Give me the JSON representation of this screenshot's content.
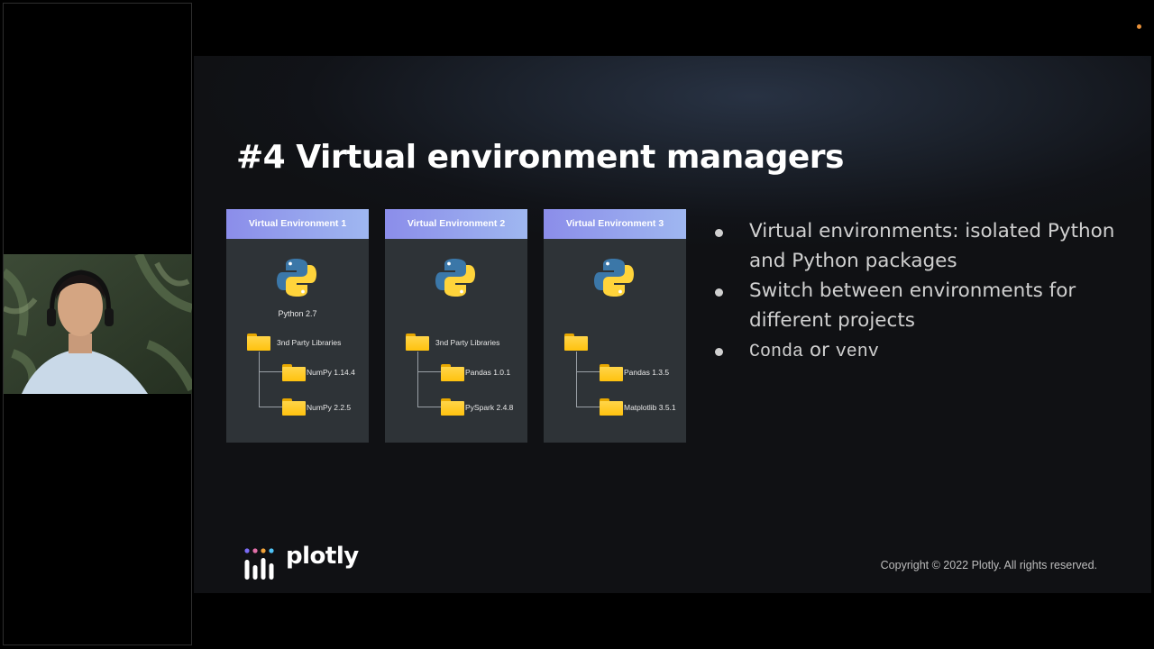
{
  "slide": {
    "title": "#4 Virtual environment managers",
    "environments": [
      {
        "header": "Virtual Environment 1",
        "python_version": "Python 2.7",
        "root_folder": "3nd Party Libraries",
        "packages": [
          "NumPy 1.14.4",
          "NumPy 2.2.5"
        ]
      },
      {
        "header": "Virtual Environment 2",
        "python_version": "",
        "root_folder": "3nd Party Libraries",
        "packages": [
          "Pandas 1.0.1",
          "PySpark 2.4.8"
        ]
      },
      {
        "header": "Virtual Environment 3",
        "python_version": "",
        "root_folder": "",
        "packages": [
          "Pandas 1.3.5",
          "Matplotlib 3.5.1"
        ]
      }
    ],
    "bullets": [
      "Virtual environments: isolated Python and Python packages",
      "Switch between environments for different projects"
    ],
    "bullet3": {
      "conda": "Conda",
      "or": " or ",
      "venv": "venv"
    },
    "brand": "plotly",
    "copyright": "Copyright © 2022 Plotly. All rights reserved."
  },
  "colors": {
    "header_gradient_start": "#8b8dea",
    "header_gradient_end": "#9fb7f0",
    "card_bg": "#2e3337",
    "folder": "#ffc20e",
    "python_blue": "#3b77a8",
    "python_yellow": "#ffd43b",
    "status_dot": "#e8913a"
  },
  "icons": [
    "python-logo-icon",
    "folder-icon",
    "plotly-logo-icon",
    "person-video-feed"
  ]
}
